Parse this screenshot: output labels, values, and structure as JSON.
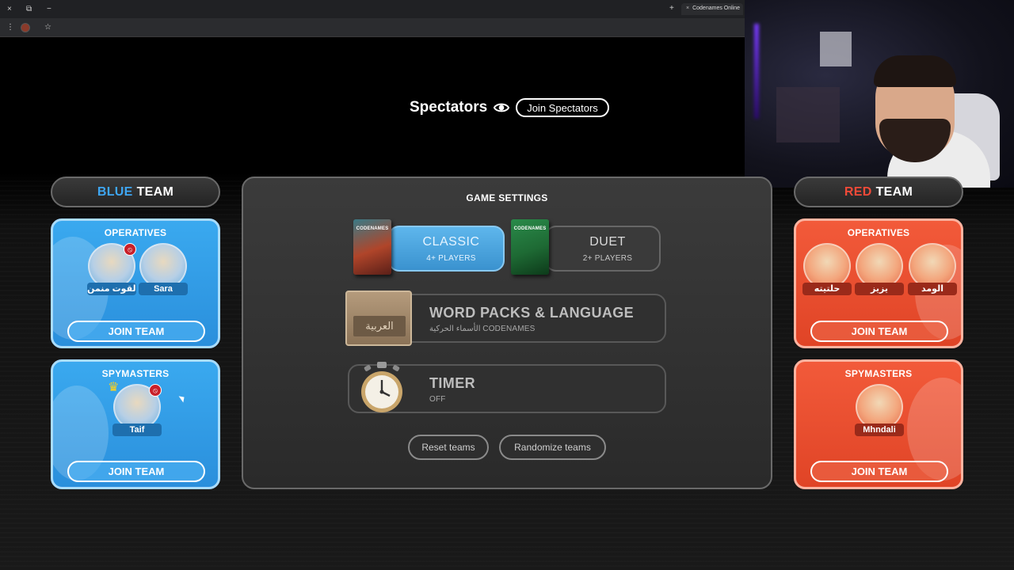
{
  "browser": {
    "tab_title": "Codenames Online",
    "tab_close_icon": "×",
    "new_tab_icon": "+",
    "window_close_icon": "×",
    "window_restore_icon": "⧉",
    "window_minimize_icon": "−",
    "menu_icon": "⋮",
    "bookmark_icon": "☆"
  },
  "spectators": {
    "label": "Spectators",
    "icon": "eye-icon",
    "join_label": "Join Spectators"
  },
  "blue_team": {
    "color_word": "BLUE",
    "team_word": "TEAM",
    "accent": "#3ea6f2",
    "operatives": {
      "title": "OPERATIVES",
      "players": [
        {
          "name": "القوت منمن",
          "badge": "wifi-off-icon"
        },
        {
          "name": "Sara"
        }
      ],
      "join_label": "JOIN TEAM"
    },
    "spymasters": {
      "title": "SPYMASTERS",
      "players": [
        {
          "name": "Taif",
          "badge": "wifi-off-icon",
          "crown": true
        }
      ],
      "join_label": "JOIN TEAM"
    }
  },
  "red_team": {
    "color_word": "RED",
    "team_word": "TEAM",
    "accent": "#f24a38",
    "operatives": {
      "title": "OPERATIVES",
      "players": [
        {
          "name": "حلتيته"
        },
        {
          "name": "يزيز"
        },
        {
          "name": "الومد"
        }
      ],
      "join_label": "JOIN TEAM"
    },
    "spymasters": {
      "title": "SPYMASTERS",
      "players": [
        {
          "name": "Mhndali"
        }
      ],
      "join_label": "JOIN TEAM"
    }
  },
  "settings": {
    "title": "GAME SETTINGS",
    "modes": [
      {
        "label": "CLASSIC",
        "sub": "4+ PLAYERS",
        "selected": true,
        "box_text": "CODENAMES"
      },
      {
        "label": "DUET",
        "sub": "2+ PLAYERS",
        "selected": false,
        "box_text": "CODENAMES"
      }
    ],
    "word_packs": {
      "title": "WORD PACKS & LANGUAGE",
      "sub": "الأسماء الحركية CODENAMES",
      "card_text": "العربية"
    },
    "timer": {
      "title": "TIMER",
      "sub": "OFF"
    },
    "reset_label": "Reset teams",
    "randomize_label": "Randomize teams"
  }
}
